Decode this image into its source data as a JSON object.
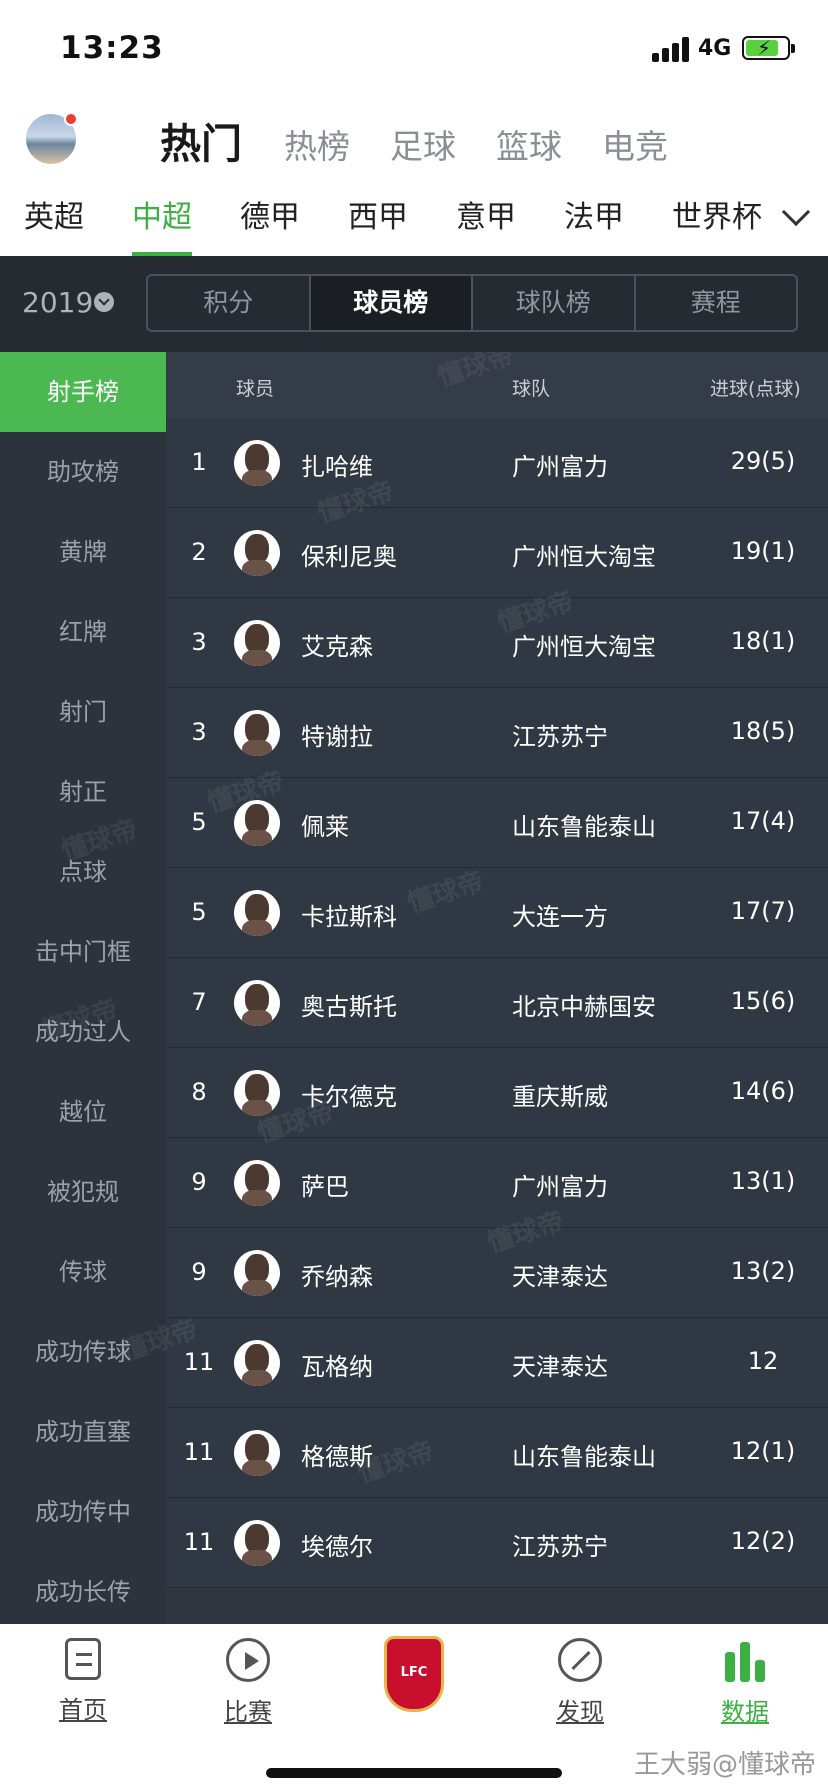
{
  "status": {
    "time": "13:23",
    "network": "4G"
  },
  "top_tabs": [
    "热门",
    "热榜",
    "足球",
    "篮球",
    "电竞"
  ],
  "league_tabs": [
    "英超",
    "中超",
    "德甲",
    "西甲",
    "意甲",
    "法甲",
    "世界杯"
  ],
  "filter": {
    "year": "2019",
    "segments": [
      "积分",
      "球员榜",
      "球队榜",
      "赛程"
    ]
  },
  "menu": [
    "射手榜",
    "助攻榜",
    "黄牌",
    "红牌",
    "射门",
    "射正",
    "点球",
    "击中门框",
    "成功过人",
    "越位",
    "被犯规",
    "传球",
    "成功传球",
    "成功直塞",
    "成功传中",
    "成功长传"
  ],
  "table": {
    "headers": {
      "player": "球员",
      "team": "球队",
      "goals": "进球(点球)"
    },
    "rows": [
      {
        "rank": "1",
        "name": "扎哈维",
        "team": "广州富力",
        "goals": "29(5)"
      },
      {
        "rank": "2",
        "name": "保利尼奥",
        "team": "广州恒大淘宝",
        "goals": "19(1)"
      },
      {
        "rank": "3",
        "name": "艾克森",
        "team": "广州恒大淘宝",
        "goals": "18(1)"
      },
      {
        "rank": "3",
        "name": "特谢拉",
        "team": "江苏苏宁",
        "goals": "18(5)"
      },
      {
        "rank": "5",
        "name": "佩莱",
        "team": "山东鲁能泰山",
        "goals": "17(4)"
      },
      {
        "rank": "5",
        "name": "卡拉斯科",
        "team": "大连一方",
        "goals": "17(7)"
      },
      {
        "rank": "7",
        "name": "奥古斯托",
        "team": "北京中赫国安",
        "goals": "15(6)"
      },
      {
        "rank": "8",
        "name": "卡尔德克",
        "team": "重庆斯威",
        "goals": "14(6)"
      },
      {
        "rank": "9",
        "name": "萨巴",
        "team": "广州富力",
        "goals": "13(1)"
      },
      {
        "rank": "9",
        "name": "乔纳森",
        "team": "天津泰达",
        "goals": "13(2)"
      },
      {
        "rank": "11",
        "name": "瓦格纳",
        "team": "天津泰达",
        "goals": "12"
      },
      {
        "rank": "11",
        "name": "格德斯",
        "team": "山东鲁能泰山",
        "goals": "12(1)"
      },
      {
        "rank": "11",
        "name": "埃德尔",
        "team": "江苏苏宁",
        "goals": "12(2)"
      }
    ]
  },
  "watermark": "懂球帝",
  "bottom_nav": [
    "首页",
    "比赛",
    "发现",
    "数据"
  ],
  "credit": "王大弱@懂球帝",
  "colors": {
    "accent": "#3cb043",
    "panel": "#2f3640",
    "sidebar": "#2c333d"
  }
}
